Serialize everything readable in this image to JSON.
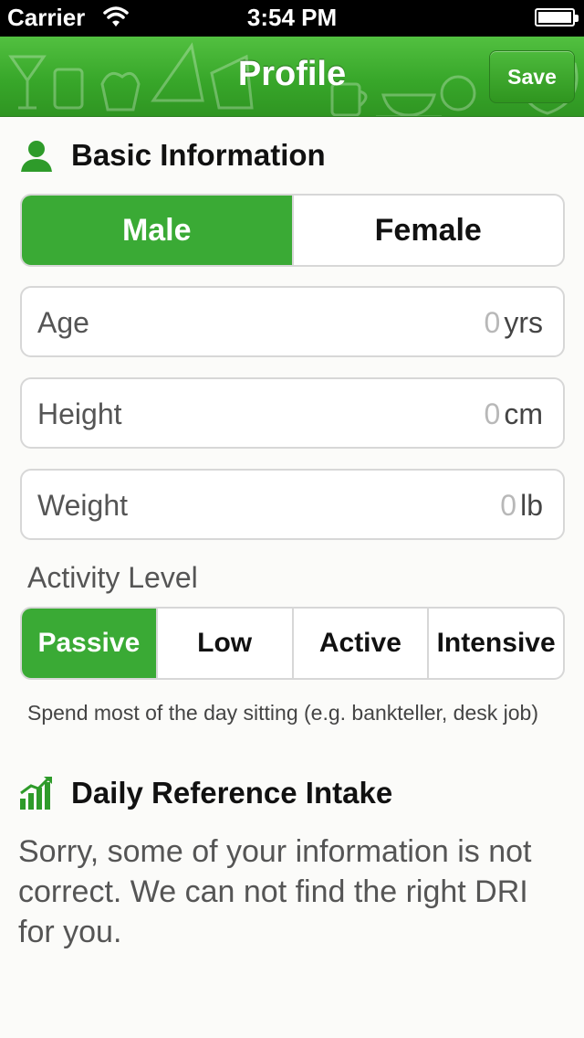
{
  "status_bar": {
    "carrier": "Carrier",
    "time": "3:54 PM"
  },
  "nav": {
    "title": "Profile",
    "save_label": "Save"
  },
  "basic_info": {
    "title": "Basic Information",
    "icon": "person-icon"
  },
  "gender": {
    "options": [
      "Male",
      "Female"
    ],
    "selected": "Male"
  },
  "fields": {
    "age": {
      "label": "Age",
      "value": "0",
      "unit": "yrs"
    },
    "height": {
      "label": "Height",
      "value": "0",
      "unit": "cm"
    },
    "weight": {
      "label": "Weight",
      "value": "0",
      "unit": "lb"
    }
  },
  "activity": {
    "label": "Activity Level",
    "options": [
      "Passive",
      "Low",
      "Active",
      "Intensive"
    ],
    "selected": "Passive",
    "description": "Spend most of the day sitting (e.g. bankteller, desk job)"
  },
  "dri": {
    "title": "Daily Reference Intake",
    "icon": "bar-chart-icon",
    "message": "Sorry, some of your information is not correct. We can not find the right DRI for you."
  },
  "colors": {
    "accent": "#3aaa35",
    "nav_top": "#52c040",
    "nav_bottom": "#2f9522"
  }
}
